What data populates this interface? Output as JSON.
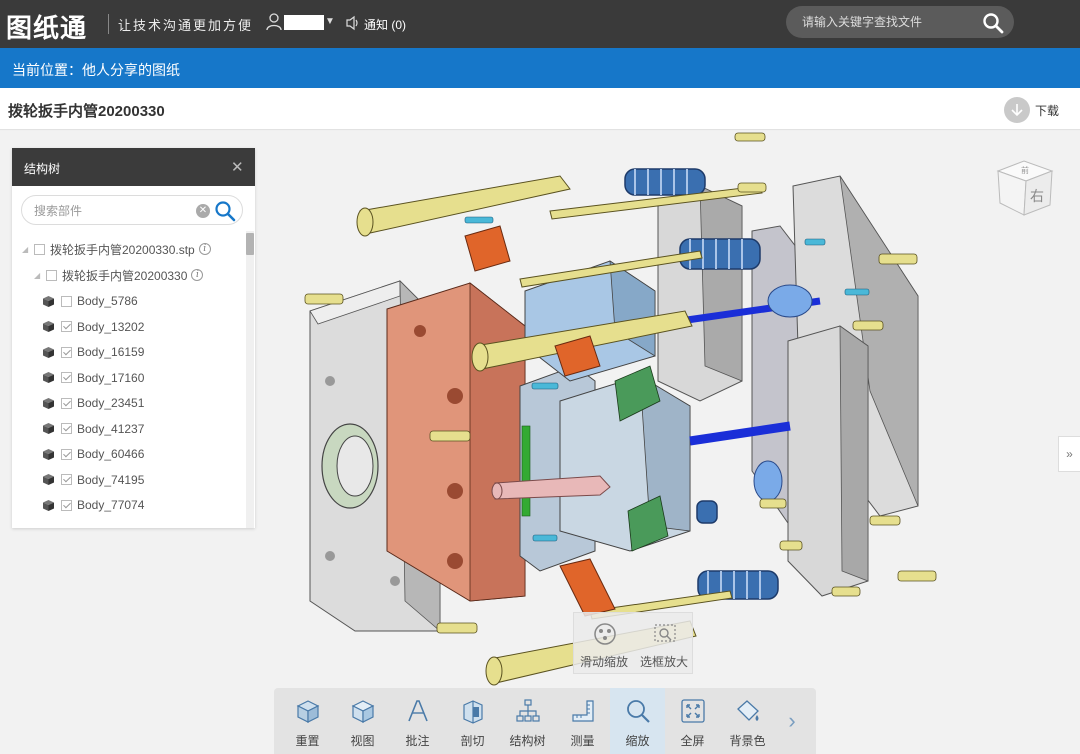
{
  "header": {
    "logo": "图纸通",
    "slogan": "让技术沟通更加方便",
    "notification_label": "通知 (0)",
    "search_placeholder": "请输入关键字查找文件"
  },
  "breadcrumb": "当前位置：他人分享的图纸",
  "document": {
    "title": "拨轮扳手内管20200330",
    "download_label": "下载"
  },
  "tree": {
    "title": "结构树",
    "search_placeholder": "搜索部件",
    "root": "拨轮扳手内管20200330.stp",
    "assembly": "拨轮扳手内管20200330",
    "bodies": [
      {
        "name": "Body_5786",
        "checked": false
      },
      {
        "name": "Body_13202",
        "checked": true
      },
      {
        "name": "Body_16159",
        "checked": true
      },
      {
        "name": "Body_17160",
        "checked": true
      },
      {
        "name": "Body_23451",
        "checked": true
      },
      {
        "name": "Body_41237",
        "checked": true
      },
      {
        "name": "Body_60466",
        "checked": true
      },
      {
        "name": "Body_74195",
        "checked": true
      },
      {
        "name": "Body_77074",
        "checked": true
      }
    ]
  },
  "viewcube": {
    "face_label": "右",
    "top_label": "前"
  },
  "zoom_popup": {
    "slide_zoom": "滑动缩放",
    "box_zoom": "选框放大"
  },
  "toolbar": {
    "reset": "重置",
    "view": "视图",
    "annotate": "批注",
    "section": "剖切",
    "structure_tree": "结构树",
    "measure": "测量",
    "zoom": "缩放",
    "fullscreen": "全屏",
    "background": "背景色"
  },
  "colors": {
    "topbar": "#3a3a3a",
    "breadcrumb": "#1677c9",
    "active_tool": "#d7e5f0"
  }
}
